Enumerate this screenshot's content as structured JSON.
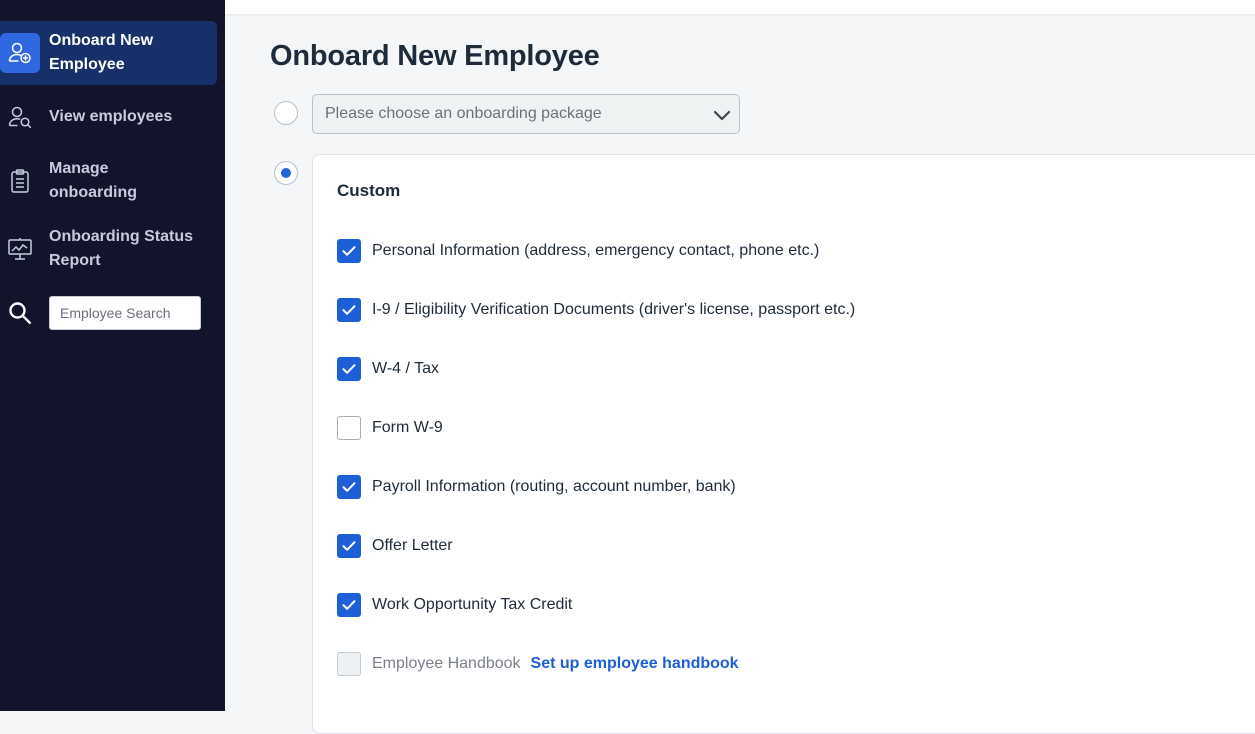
{
  "sidebar": {
    "items": [
      {
        "label": "Onboard New Employee",
        "icon": "add-user-icon",
        "active": true
      },
      {
        "label": "View employees",
        "icon": "user-search-icon"
      },
      {
        "label": "Manage onboarding",
        "icon": "clipboard-icon"
      },
      {
        "label": "Onboarding Status Report",
        "icon": "chart-board-icon"
      }
    ],
    "search": {
      "placeholder": "Employee Search",
      "value": "",
      "icon": "search-icon"
    }
  },
  "main": {
    "title": "Onboard New Employee",
    "package_select": {
      "placeholder": "Please choose an onboarding package",
      "selected": false
    },
    "custom": {
      "selected": true,
      "title": "Custom",
      "options": [
        {
          "label": "Personal Information (address, emergency contact, phone etc.)",
          "checked": true
        },
        {
          "label": "I-9 / Eligibility Verification Documents (driver's license, passport etc.)",
          "checked": true
        },
        {
          "label": "W-4 / Tax",
          "checked": true
        },
        {
          "label": "Form W-9",
          "checked": false
        },
        {
          "label": "Payroll Information (routing, account number, bank)",
          "checked": true
        },
        {
          "label": "Offer Letter",
          "checked": true
        },
        {
          "label": "Work Opportunity Tax Credit",
          "checked": true
        },
        {
          "label": "Employee Handbook",
          "checked": false,
          "disabled": true,
          "link": "Set up employee handbook"
        }
      ]
    }
  },
  "colors": {
    "sidebar_bg": "#12142b",
    "accent": "#1d5fd6",
    "active_bg": "#17306a"
  }
}
